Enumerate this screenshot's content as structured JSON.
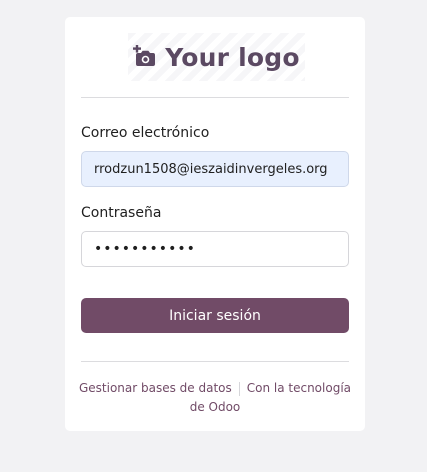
{
  "logo": {
    "text": "Your logo",
    "icon": "add-photo-icon"
  },
  "form": {
    "email_label": "Correo electrónico",
    "email_value": "rrodzun1508@ieszaidinvergeles.org",
    "password_label": "Contraseña",
    "password_value": "•••••••••••",
    "submit_label": "Iniciar sesión"
  },
  "footer": {
    "manage_db_label": "Gestionar bases de datos",
    "powered_by_label": "Con la tecnología de",
    "powered_by_brand": "Odoo"
  },
  "colors": {
    "brand": "#714b67",
    "logo_text": "#5b4962",
    "autofill_bg": "#e8f0fe",
    "page_bg": "#f2f2f4"
  }
}
